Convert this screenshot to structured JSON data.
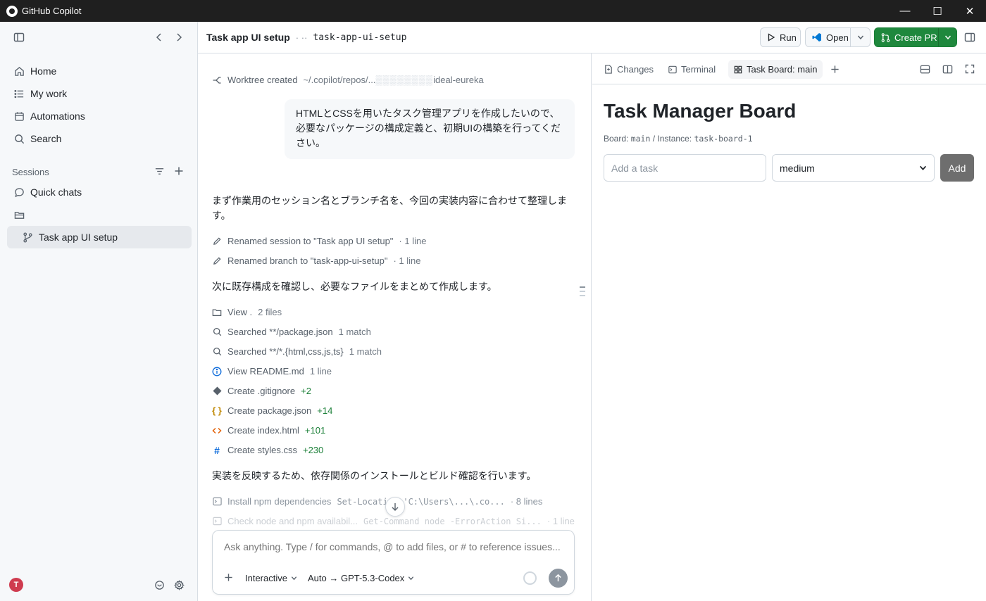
{
  "window": {
    "title": "GitHub Copilot",
    "controls": {
      "minimize": "—",
      "maximize": "☐",
      "close": "✕"
    }
  },
  "sidebar": {
    "nav": [
      {
        "label": "Home",
        "icon": "home-icon"
      },
      {
        "label": "My work",
        "icon": "list-icon"
      },
      {
        "label": "Automations",
        "icon": "calendar-icon"
      },
      {
        "label": "Search",
        "icon": "search-icon"
      }
    ],
    "sessions_label": "Sessions",
    "sessions": [
      {
        "label": "Quick chats",
        "icon": "chat-icon"
      },
      {
        "label": "",
        "icon": "folder-icon"
      },
      {
        "label": "Task app UI setup",
        "icon": "branch-icon",
        "active": true
      }
    ],
    "avatar_initial": "T"
  },
  "header": {
    "session_title": "Task app UI setup",
    "branch_prefix": "· ·· ",
    "branch": "task-app-ui-setup",
    "run_label": "Run",
    "open_label": "Open",
    "create_pr_label": "Create PR"
  },
  "chat": {
    "worktree_label": "Worktree created",
    "worktree_path": "~/.copilot/repos/...",
    "worktree_suffix": "ideal-eureka",
    "user_message": "HTMLとCSSを用いたタスク管理アプリを作成したいので、必要なパッケージの構成定義と、初期UIの構築を行ってください。",
    "assistant_1": "まず作業用のセッション名とブランチ名を、今回の実装内容に合わせて整理します。",
    "rename_session": "Renamed session to \"Task app UI setup\"",
    "rename_branch": "Renamed branch to \"task-app-ui-setup\"",
    "one_line": "· 1 line",
    "assistant_2": "次に既存構成を確認し、必要なファイルをまとめて作成します。",
    "actions": [
      {
        "label": "View .",
        "meta": "2 files",
        "kind": "meta"
      },
      {
        "label": "Searched **/package.json",
        "meta": "1 match",
        "kind": "meta"
      },
      {
        "label": "Searched **/*.{html,css,js,ts}",
        "meta": "1 match",
        "kind": "meta"
      },
      {
        "label": "View README.md",
        "meta": "1 line",
        "kind": "meta"
      },
      {
        "label": "Create .gitignore",
        "meta": "+2",
        "kind": "plus"
      },
      {
        "label": "Create package.json",
        "meta": "+14",
        "kind": "plus"
      },
      {
        "label": "Create index.html",
        "meta": "+101",
        "kind": "plus"
      },
      {
        "label": "Create styles.css",
        "meta": "+230",
        "kind": "plus"
      }
    ],
    "assistant_3": "実装を反映するため、依存関係のインストールとビルド確認を行います。",
    "install_label": "Install npm dependencies",
    "install_cmd": "Set-Location 'C:\\Users\\...\\.co...",
    "install_meta": "· 8 lines",
    "check_label": "Check node and npm availabil...",
    "check_cmd": "Get-Command node -ErrorAction Si...",
    "check_meta": "· 1 line",
    "composer_placeholder": "Ask anything. Type / for commands, @ to add files, or # to reference issues...",
    "mode_label": "Interactive",
    "model_label": "Auto → GPT-5.3-Codex"
  },
  "panel": {
    "tabs": [
      {
        "label": "Changes"
      },
      {
        "label": "Terminal"
      },
      {
        "label": "Task Board: main"
      }
    ],
    "board": {
      "title": "Task Manager Board",
      "board_prefix": "Board: ",
      "board_name": "main",
      "instance_prefix": " / Instance: ",
      "instance_name": "task-board-1",
      "input_placeholder": "Add a task",
      "priority": "medium",
      "add_label": "Add"
    }
  }
}
